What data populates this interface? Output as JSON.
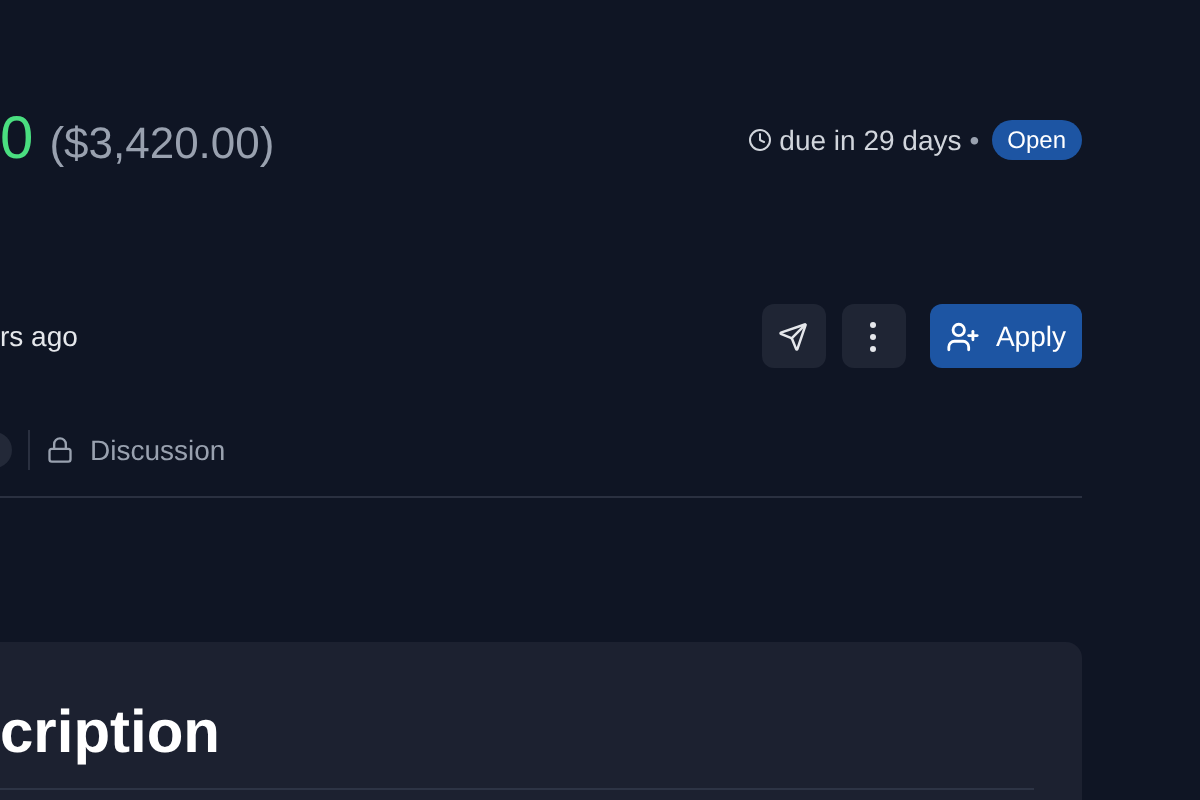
{
  "bounty": {
    "amount": "0",
    "amount_usd": "($3,420.00)",
    "due": "due in 29 days",
    "separator": "•",
    "status": "Open"
  },
  "meta": {
    "posted": "rs ago"
  },
  "actions": [
    {
      "kind": "share"
    },
    {
      "kind": "more"
    },
    {
      "kind": "apply",
      "label": "Apply"
    }
  ],
  "tabs": [
    {
      "label": "Discussion",
      "selected": false
    }
  ],
  "card": {
    "title": "cription"
  }
}
